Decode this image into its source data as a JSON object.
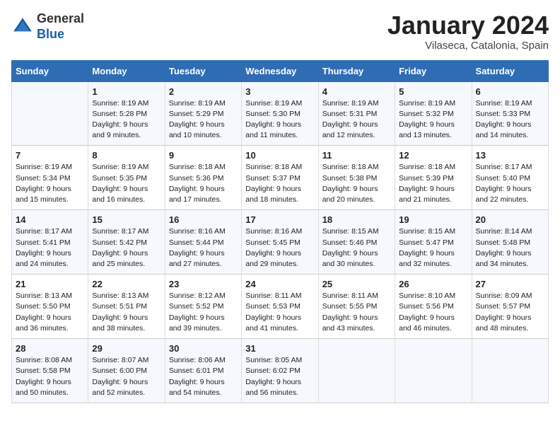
{
  "header": {
    "logo_general": "General",
    "logo_blue": "Blue",
    "month_title": "January 2024",
    "subtitle": "Vilaseca, Catalonia, Spain"
  },
  "weekdays": [
    "Sunday",
    "Monday",
    "Tuesday",
    "Wednesday",
    "Thursday",
    "Friday",
    "Saturday"
  ],
  "weeks": [
    [
      {
        "day": "",
        "content": ""
      },
      {
        "day": "1",
        "content": "Sunrise: 8:19 AM\nSunset: 5:28 PM\nDaylight: 9 hours\nand 9 minutes."
      },
      {
        "day": "2",
        "content": "Sunrise: 8:19 AM\nSunset: 5:29 PM\nDaylight: 9 hours\nand 10 minutes."
      },
      {
        "day": "3",
        "content": "Sunrise: 8:19 AM\nSunset: 5:30 PM\nDaylight: 9 hours\nand 11 minutes."
      },
      {
        "day": "4",
        "content": "Sunrise: 8:19 AM\nSunset: 5:31 PM\nDaylight: 9 hours\nand 12 minutes."
      },
      {
        "day": "5",
        "content": "Sunrise: 8:19 AM\nSunset: 5:32 PM\nDaylight: 9 hours\nand 13 minutes."
      },
      {
        "day": "6",
        "content": "Sunrise: 8:19 AM\nSunset: 5:33 PM\nDaylight: 9 hours\nand 14 minutes."
      }
    ],
    [
      {
        "day": "7",
        "content": "Sunrise: 8:19 AM\nSunset: 5:34 PM\nDaylight: 9 hours\nand 15 minutes."
      },
      {
        "day": "8",
        "content": "Sunrise: 8:19 AM\nSunset: 5:35 PM\nDaylight: 9 hours\nand 16 minutes."
      },
      {
        "day": "9",
        "content": "Sunrise: 8:18 AM\nSunset: 5:36 PM\nDaylight: 9 hours\nand 17 minutes."
      },
      {
        "day": "10",
        "content": "Sunrise: 8:18 AM\nSunset: 5:37 PM\nDaylight: 9 hours\nand 18 minutes."
      },
      {
        "day": "11",
        "content": "Sunrise: 8:18 AM\nSunset: 5:38 PM\nDaylight: 9 hours\nand 20 minutes."
      },
      {
        "day": "12",
        "content": "Sunrise: 8:18 AM\nSunset: 5:39 PM\nDaylight: 9 hours\nand 21 minutes."
      },
      {
        "day": "13",
        "content": "Sunrise: 8:17 AM\nSunset: 5:40 PM\nDaylight: 9 hours\nand 22 minutes."
      }
    ],
    [
      {
        "day": "14",
        "content": "Sunrise: 8:17 AM\nSunset: 5:41 PM\nDaylight: 9 hours\nand 24 minutes."
      },
      {
        "day": "15",
        "content": "Sunrise: 8:17 AM\nSunset: 5:42 PM\nDaylight: 9 hours\nand 25 minutes."
      },
      {
        "day": "16",
        "content": "Sunrise: 8:16 AM\nSunset: 5:44 PM\nDaylight: 9 hours\nand 27 minutes."
      },
      {
        "day": "17",
        "content": "Sunrise: 8:16 AM\nSunset: 5:45 PM\nDaylight: 9 hours\nand 29 minutes."
      },
      {
        "day": "18",
        "content": "Sunrise: 8:15 AM\nSunset: 5:46 PM\nDaylight: 9 hours\nand 30 minutes."
      },
      {
        "day": "19",
        "content": "Sunrise: 8:15 AM\nSunset: 5:47 PM\nDaylight: 9 hours\nand 32 minutes."
      },
      {
        "day": "20",
        "content": "Sunrise: 8:14 AM\nSunset: 5:48 PM\nDaylight: 9 hours\nand 34 minutes."
      }
    ],
    [
      {
        "day": "21",
        "content": "Sunrise: 8:13 AM\nSunset: 5:50 PM\nDaylight: 9 hours\nand 36 minutes."
      },
      {
        "day": "22",
        "content": "Sunrise: 8:13 AM\nSunset: 5:51 PM\nDaylight: 9 hours\nand 38 minutes."
      },
      {
        "day": "23",
        "content": "Sunrise: 8:12 AM\nSunset: 5:52 PM\nDaylight: 9 hours\nand 39 minutes."
      },
      {
        "day": "24",
        "content": "Sunrise: 8:11 AM\nSunset: 5:53 PM\nDaylight: 9 hours\nand 41 minutes."
      },
      {
        "day": "25",
        "content": "Sunrise: 8:11 AM\nSunset: 5:55 PM\nDaylight: 9 hours\nand 43 minutes."
      },
      {
        "day": "26",
        "content": "Sunrise: 8:10 AM\nSunset: 5:56 PM\nDaylight: 9 hours\nand 46 minutes."
      },
      {
        "day": "27",
        "content": "Sunrise: 8:09 AM\nSunset: 5:57 PM\nDaylight: 9 hours\nand 48 minutes."
      }
    ],
    [
      {
        "day": "28",
        "content": "Sunrise: 8:08 AM\nSunset: 5:58 PM\nDaylight: 9 hours\nand 50 minutes."
      },
      {
        "day": "29",
        "content": "Sunrise: 8:07 AM\nSunset: 6:00 PM\nDaylight: 9 hours\nand 52 minutes."
      },
      {
        "day": "30",
        "content": "Sunrise: 8:06 AM\nSunset: 6:01 PM\nDaylight: 9 hours\nand 54 minutes."
      },
      {
        "day": "31",
        "content": "Sunrise: 8:05 AM\nSunset: 6:02 PM\nDaylight: 9 hours\nand 56 minutes."
      },
      {
        "day": "",
        "content": ""
      },
      {
        "day": "",
        "content": ""
      },
      {
        "day": "",
        "content": ""
      }
    ]
  ]
}
